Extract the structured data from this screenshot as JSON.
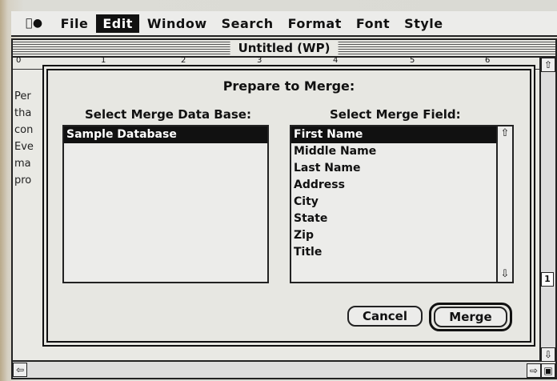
{
  "menubar": {
    "items": [
      "File",
      "Edit",
      "Window",
      "Search",
      "Format",
      "Font",
      "Style"
    ]
  },
  "window": {
    "title": "Untitled (WP)",
    "ruler_marks": [
      "0",
      "1",
      "2",
      "3",
      "4",
      "5",
      "6"
    ],
    "doc_lines": [
      "Per",
      "tha",
      "con",
      "Eve",
      "ma",
      "pro"
    ],
    "page_number": "1"
  },
  "dialog": {
    "title": "Prepare to Merge:",
    "left_label": "Select Merge Data Base:",
    "right_label": "Select Merge Field:",
    "databases": [
      "Sample Database"
    ],
    "fields": [
      "First Name",
      "Middle Name",
      "Last Name",
      "Address",
      "City",
      "State",
      "Zip",
      "Title"
    ],
    "cancel_label": "Cancel",
    "merge_label": "Merge"
  }
}
